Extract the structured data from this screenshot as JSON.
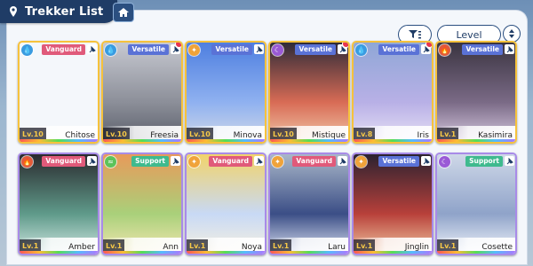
{
  "header": {
    "title": "Trekker List"
  },
  "toolbar": {
    "sort_label": "Level"
  },
  "colors": {
    "header_bg": "#1f3c66",
    "vanguard": "#e05a7a",
    "versatile": "#5a72d6",
    "support": "#3fba8e",
    "level_text": "#f7c948"
  },
  "cards": [
    {
      "name": "Chitose",
      "level": "Lv.10",
      "role": "Vanguard",
      "element": "water",
      "frame": "gold",
      "new_dot": false
    },
    {
      "name": "Freesia",
      "level": "Lv.10",
      "role": "Versatile",
      "element": "water",
      "frame": "gold",
      "new_dot": true
    },
    {
      "name": "Minova",
      "level": "Lv.10",
      "role": "Versatile",
      "element": "light",
      "frame": "gold",
      "new_dot": false
    },
    {
      "name": "Mistique",
      "level": "Lv.10",
      "role": "Versatile",
      "element": "dark",
      "frame": "gold",
      "new_dot": true
    },
    {
      "name": "Iris",
      "level": "Lv.8",
      "role": "Versatile",
      "element": "water",
      "frame": "gold",
      "new_dot": true
    },
    {
      "name": "Kasimira",
      "level": "Lv.1",
      "role": "Versatile",
      "element": "fire",
      "frame": "gold",
      "new_dot": false
    },
    {
      "name": "Amber",
      "level": "Lv.1",
      "role": "Vanguard",
      "element": "fire",
      "frame": "purple",
      "new_dot": false
    },
    {
      "name": "Ann",
      "level": "Lv.1",
      "role": "Support",
      "element": "wind",
      "frame": "purple",
      "new_dot": false
    },
    {
      "name": "Noya",
      "level": "Lv.1",
      "role": "Vanguard",
      "element": "light",
      "frame": "purple",
      "new_dot": false
    },
    {
      "name": "Laru",
      "level": "Lv.1",
      "role": "Vanguard",
      "element": "light",
      "frame": "purple",
      "new_dot": false
    },
    {
      "name": "Jinglin",
      "level": "Lv.1",
      "role": "Versatile",
      "element": "light",
      "frame": "purple",
      "new_dot": false
    },
    {
      "name": "Cosette",
      "level": "Lv.1",
      "role": "Support",
      "element": "dark",
      "frame": "purple",
      "new_dot": false
    }
  ]
}
